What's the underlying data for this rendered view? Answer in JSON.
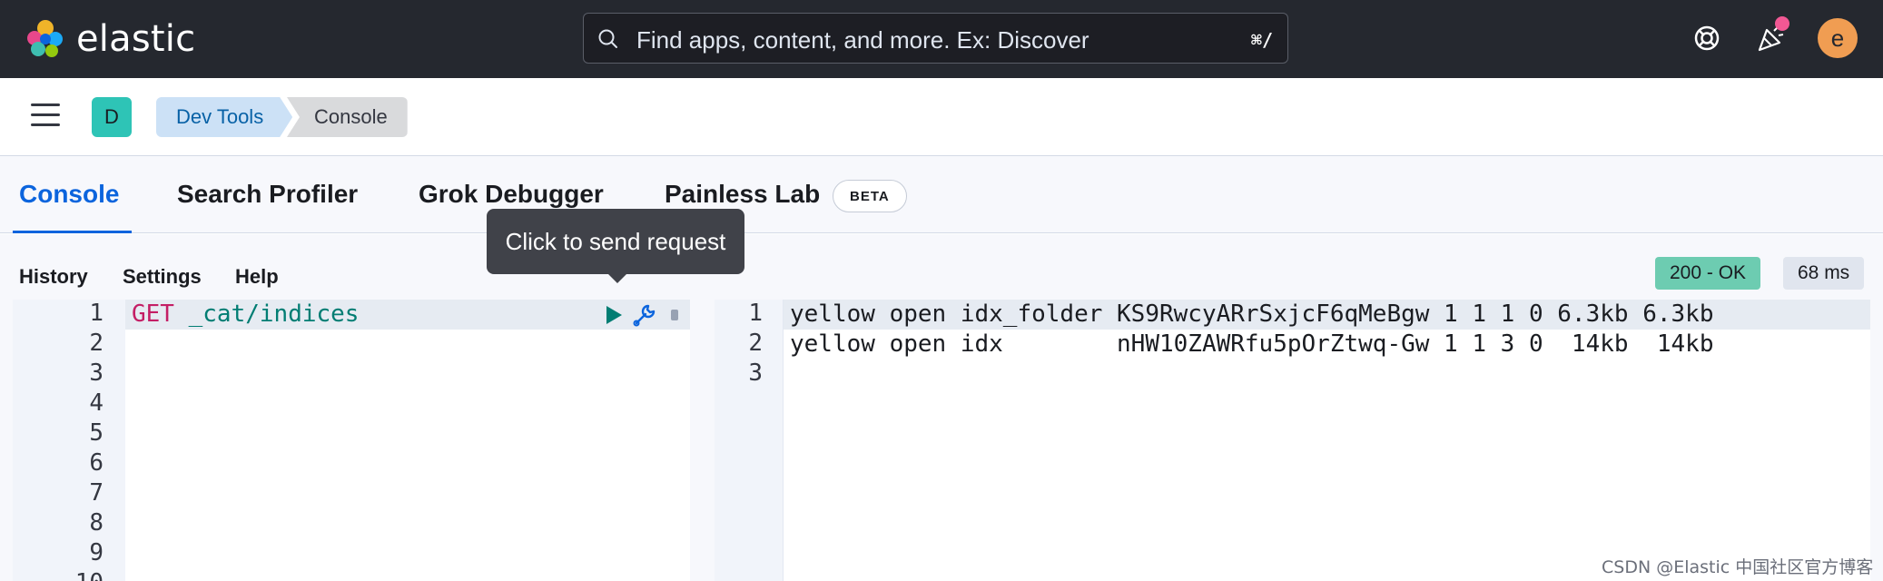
{
  "header": {
    "logo_text": "elastic",
    "search_placeholder": "Find apps, content, and more. Ex: Discover",
    "search_shortcut": "⌘/",
    "avatar_letter": "e",
    "news_dot_color": "#f15894"
  },
  "subbar": {
    "space_badge": "D",
    "breadcrumbs": [
      "Dev Tools",
      "Console"
    ]
  },
  "tabs": [
    {
      "label": "Console",
      "selected": true
    },
    {
      "label": "Search Profiler",
      "selected": false
    },
    {
      "label": "Grok Debugger",
      "selected": false
    },
    {
      "label": "Painless Lab",
      "selected": false,
      "badge": "BETA"
    }
  ],
  "console": {
    "controls": [
      "History",
      "Settings",
      "Help"
    ],
    "status": "200 - OK",
    "status_color": "#6dccb1",
    "time": "68 ms",
    "tooltip": "Click to send request",
    "request": {
      "line_numbers": [
        "1",
        "2",
        "3",
        "4",
        "5",
        "6",
        "7",
        "8",
        "9",
        "10"
      ],
      "method": "GET",
      "url": " _cat/indices"
    },
    "response": {
      "line_numbers": [
        "1",
        "2",
        "3"
      ],
      "lines": [
        "yellow open idx_folder KS9RwcyARrSxjcF6qMeBgw 1 1 1 0 6.3kb 6.3kb",
        "yellow open idx        nHW10ZAWRfu5pOrZtwq-Gw 1 1 3 0  14kb  14kb",
        ""
      ]
    }
  },
  "watermark": "CSDN @Elastic 中国社区官方博客"
}
